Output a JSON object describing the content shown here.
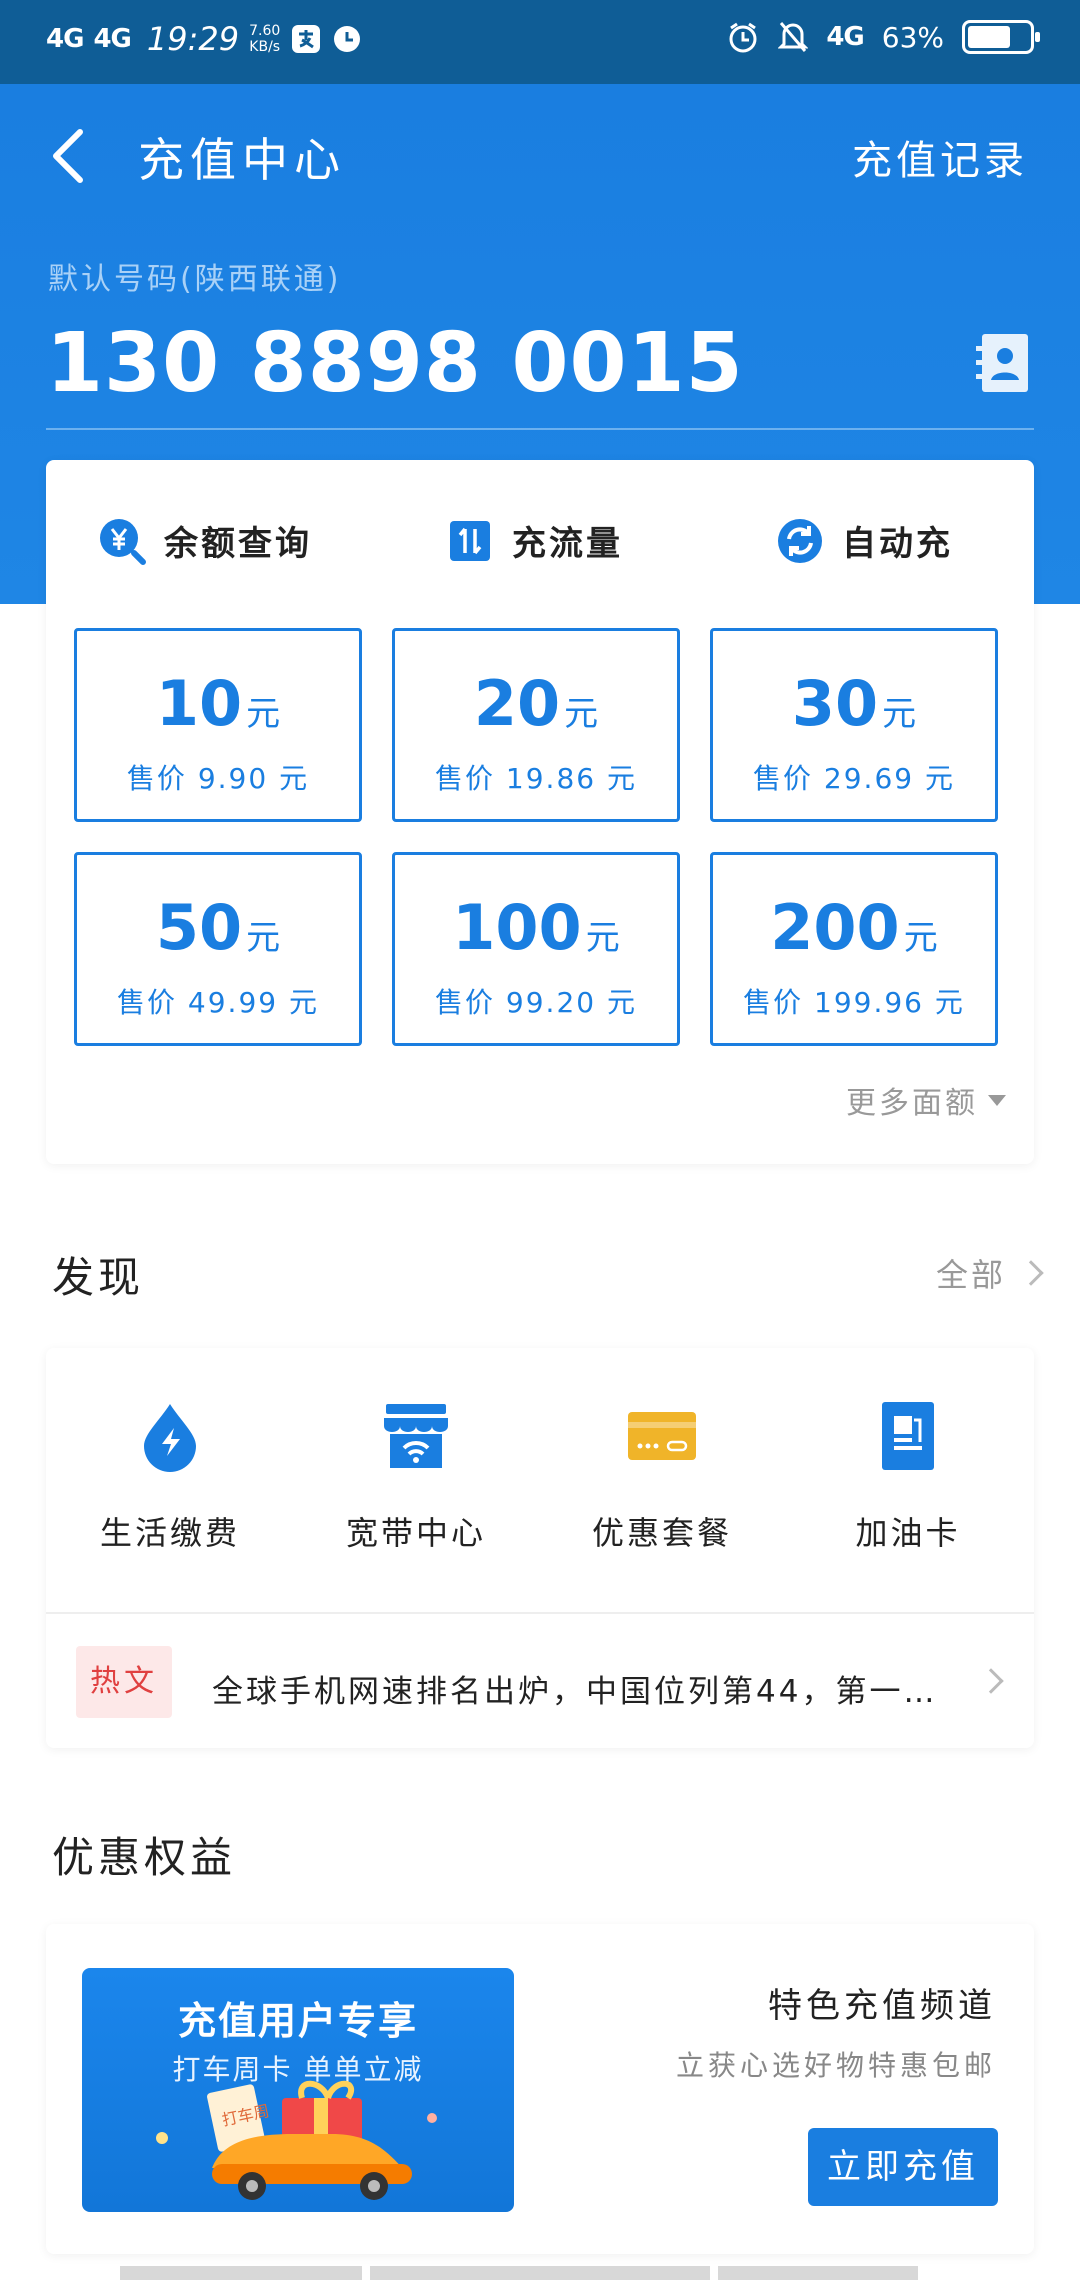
{
  "status_bar": {
    "network1": "4G",
    "network2": "4G",
    "time": "19:29",
    "speed_value": "7.60",
    "speed_unit": "KB/s",
    "network3": "4G",
    "battery": "63%",
    "battery_level": 0.63
  },
  "header": {
    "title": "充值中心",
    "record_link": "充值记录",
    "default_label": "默认号码(陕西联通)",
    "phone": "130 8898 0015"
  },
  "actions": [
    {
      "label": "余额查询",
      "icon": "yen-search-icon"
    },
    {
      "label": "充流量",
      "icon": "data-transfer-icon"
    },
    {
      "label": "自动充",
      "icon": "refresh-icon"
    }
  ],
  "tiles": [
    {
      "amount": "10",
      "unit": "元",
      "price": "售价 9.90 元"
    },
    {
      "amount": "20",
      "unit": "元",
      "price": "售价 19.86 元"
    },
    {
      "amount": "30",
      "unit": "元",
      "price": "售价 29.69 元"
    },
    {
      "amount": "50",
      "unit": "元",
      "price": "售价 49.99 元"
    },
    {
      "amount": "100",
      "unit": "元",
      "price": "售价 99.20 元"
    },
    {
      "amount": "200",
      "unit": "元",
      "price": "售价 199.96 元"
    }
  ],
  "more_amounts": "更多面额",
  "discover": {
    "title": "发现",
    "all_link": "全部",
    "items": [
      {
        "label": "生活缴费",
        "icon": "lightning-drop-icon"
      },
      {
        "label": "宽带中心",
        "icon": "broadband-store-icon"
      },
      {
        "label": "优惠套餐",
        "icon": "card-icon"
      },
      {
        "label": "加油卡",
        "icon": "fuel-card-icon"
      }
    ],
    "hot_tag": "热文",
    "hot_news": "全球手机网速排名出炉，中国位列第44，第一…"
  },
  "benefits": {
    "title": "优惠权益",
    "banner_line1": "充值用户专享",
    "banner_line2": "打车周卡 单单立减",
    "banner_ticket": "打车周",
    "promo_title": "特色充值频道",
    "promo_sub": "立获心选好物特惠包邮",
    "promo_button": "立即充值"
  },
  "colors": {
    "primary": "#1a7ee0",
    "status_bar": "#0f5d96",
    "hot_tag_bg": "#fde8e8",
    "hot_tag_text": "#e04040"
  }
}
